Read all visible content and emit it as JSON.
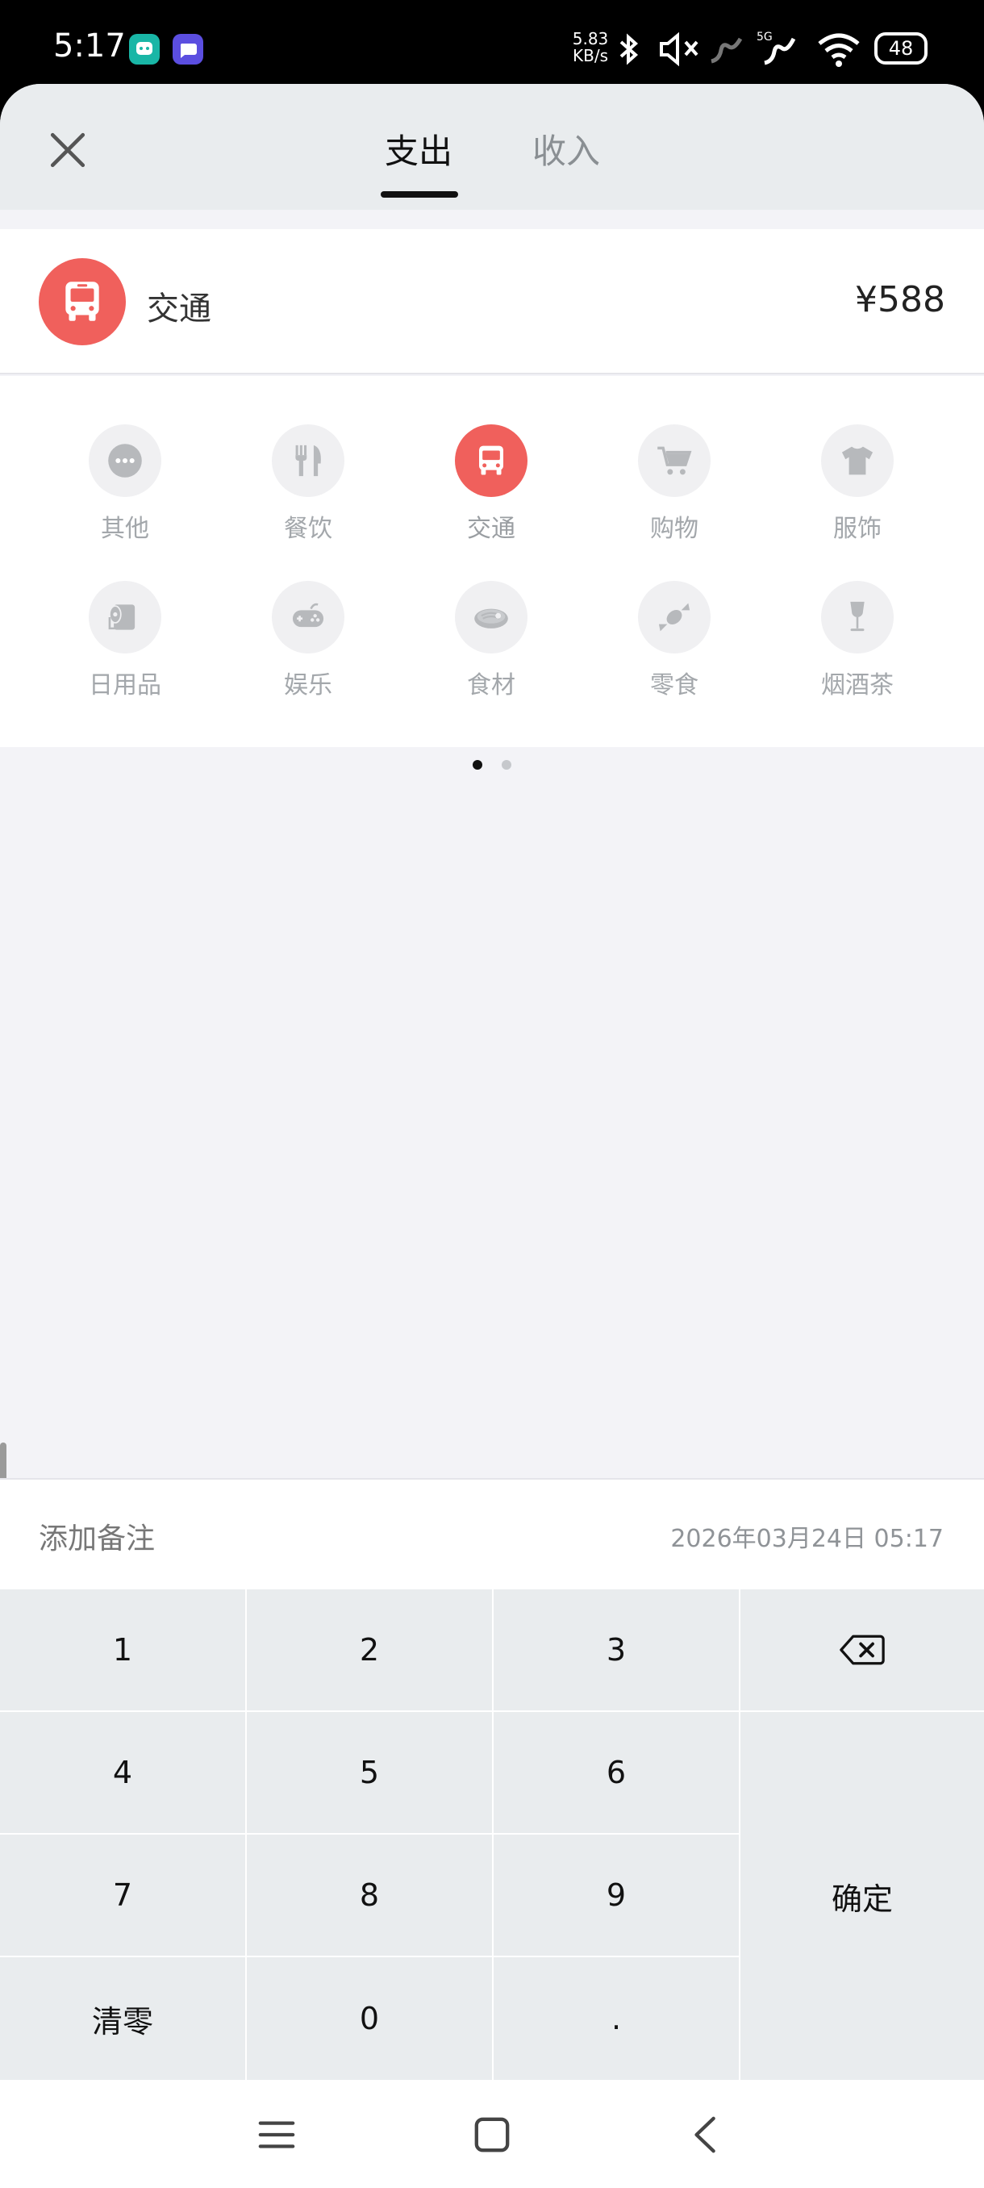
{
  "status_bar": {
    "time": "5:17",
    "speed_value": "5.83",
    "speed_unit": "KB/s",
    "battery": "48",
    "network_label": "5G"
  },
  "header": {
    "tabs": [
      {
        "label": "支出",
        "active": true
      },
      {
        "label": "收入",
        "active": false
      }
    ]
  },
  "selected": {
    "label": "交通",
    "amount": "¥588",
    "icon": "bus-icon",
    "color": "#f0605c"
  },
  "categories": [
    {
      "label": "其他",
      "icon": "more-icon"
    },
    {
      "label": "餐饮",
      "icon": "fork-knife-icon"
    },
    {
      "label": "交通",
      "icon": "bus-icon",
      "active": true
    },
    {
      "label": "购物",
      "icon": "cart-icon"
    },
    {
      "label": "服饰",
      "icon": "tshirt-icon"
    },
    {
      "label": "日用品",
      "icon": "toilet-paper-icon"
    },
    {
      "label": "娱乐",
      "icon": "gamepad-icon"
    },
    {
      "label": "食材",
      "icon": "meat-icon"
    },
    {
      "label": "零食",
      "icon": "candy-icon"
    },
    {
      "label": "烟酒茶",
      "icon": "wine-glass-icon"
    }
  ],
  "pager": {
    "pages": 2,
    "current": 1
  },
  "note": {
    "placeholder": "添加备注",
    "datetime": "2026年03月24日 05:17"
  },
  "keypad": {
    "k1": "1",
    "k2": "2",
    "k3": "3",
    "k4": "4",
    "k5": "5",
    "k6": "6",
    "k7": "7",
    "k8": "8",
    "k9": "9",
    "clear": "清零",
    "k0": "0",
    "dot": ".",
    "confirm": "确定",
    "backspace": "backspace-icon"
  },
  "colors": {
    "accent": "#f0605c",
    "header_bg": "#e9ecee",
    "key_bg": "#e9ecee",
    "page_bg": "#f3f3f7"
  }
}
